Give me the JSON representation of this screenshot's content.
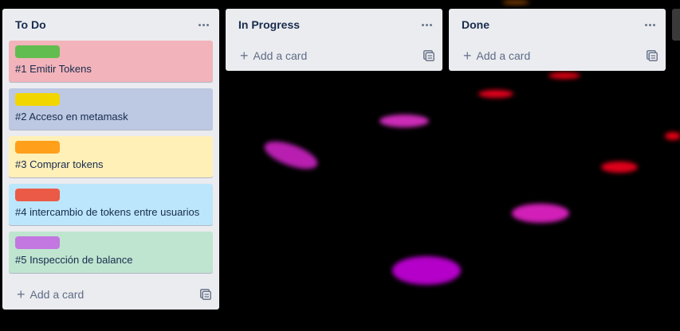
{
  "lists": [
    {
      "title": "To Do",
      "cards": [
        {
          "label_color": "#61bd4f",
          "card_bg": "#f2b3ba",
          "text": "#1 Emitir Tokens"
        },
        {
          "label_color": "#f2d600",
          "card_bg": "#bdc8e3",
          "text": "#2 Acceso en metamask"
        },
        {
          "label_color": "#ff9f1a",
          "card_bg": "#fff0b8",
          "text": "#3 Comprar tokens"
        },
        {
          "label_color": "#eb5a46",
          "card_bg": "#bce6fb",
          "text": "#4 intercambio de tokens entre usuarios"
        },
        {
          "label_color": "#c377e0",
          "card_bg": "#bfe5d0",
          "text": "#5 Inspección de balance"
        }
      ],
      "add_card_label": "Add a card"
    },
    {
      "title": "In Progress",
      "cards": [],
      "add_card_label": "Add a card"
    },
    {
      "title": "Done",
      "cards": [],
      "add_card_label": "Add a card"
    }
  ],
  "icons": {
    "menu": "more-horizontal-icon",
    "add": "plus-icon",
    "template": "card-template-icon"
  },
  "colors": {
    "list_bg": "#ebecf0",
    "board_bg": "#000000",
    "text": "#172b4d",
    "muted": "#5e6c84"
  }
}
